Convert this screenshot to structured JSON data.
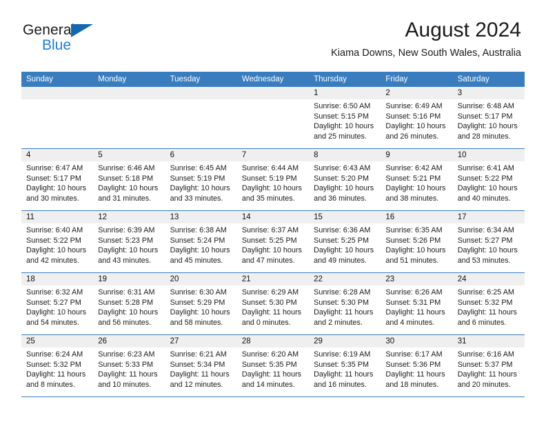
{
  "brand": {
    "name_part1": "General",
    "name_part2": "Blue",
    "triangle_color": "#1267b1",
    "blue_color": "#1b7fd4"
  },
  "header": {
    "title": "August 2024",
    "subtitle": "Kiama Downs, New South Wales, Australia"
  },
  "theme": {
    "header_blue": "#3a7dbf",
    "day_band_gray": "#efefef"
  },
  "weekdays": [
    "Sunday",
    "Monday",
    "Tuesday",
    "Wednesday",
    "Thursday",
    "Friday",
    "Saturday"
  ],
  "weeks": [
    [
      {
        "day": "",
        "lines": []
      },
      {
        "day": "",
        "lines": []
      },
      {
        "day": "",
        "lines": []
      },
      {
        "day": "",
        "lines": []
      },
      {
        "day": "1",
        "lines": [
          "Sunrise: 6:50 AM",
          "Sunset: 5:15 PM",
          "Daylight: 10 hours",
          "and 25 minutes."
        ]
      },
      {
        "day": "2",
        "lines": [
          "Sunrise: 6:49 AM",
          "Sunset: 5:16 PM",
          "Daylight: 10 hours",
          "and 26 minutes."
        ]
      },
      {
        "day": "3",
        "lines": [
          "Sunrise: 6:48 AM",
          "Sunset: 5:17 PM",
          "Daylight: 10 hours",
          "and 28 minutes."
        ]
      }
    ],
    [
      {
        "day": "4",
        "lines": [
          "Sunrise: 6:47 AM",
          "Sunset: 5:17 PM",
          "Daylight: 10 hours",
          "and 30 minutes."
        ]
      },
      {
        "day": "5",
        "lines": [
          "Sunrise: 6:46 AM",
          "Sunset: 5:18 PM",
          "Daylight: 10 hours",
          "and 31 minutes."
        ]
      },
      {
        "day": "6",
        "lines": [
          "Sunrise: 6:45 AM",
          "Sunset: 5:19 PM",
          "Daylight: 10 hours",
          "and 33 minutes."
        ]
      },
      {
        "day": "7",
        "lines": [
          "Sunrise: 6:44 AM",
          "Sunset: 5:19 PM",
          "Daylight: 10 hours",
          "and 35 minutes."
        ]
      },
      {
        "day": "8",
        "lines": [
          "Sunrise: 6:43 AM",
          "Sunset: 5:20 PM",
          "Daylight: 10 hours",
          "and 36 minutes."
        ]
      },
      {
        "day": "9",
        "lines": [
          "Sunrise: 6:42 AM",
          "Sunset: 5:21 PM",
          "Daylight: 10 hours",
          "and 38 minutes."
        ]
      },
      {
        "day": "10",
        "lines": [
          "Sunrise: 6:41 AM",
          "Sunset: 5:22 PM",
          "Daylight: 10 hours",
          "and 40 minutes."
        ]
      }
    ],
    [
      {
        "day": "11",
        "lines": [
          "Sunrise: 6:40 AM",
          "Sunset: 5:22 PM",
          "Daylight: 10 hours",
          "and 42 minutes."
        ]
      },
      {
        "day": "12",
        "lines": [
          "Sunrise: 6:39 AM",
          "Sunset: 5:23 PM",
          "Daylight: 10 hours",
          "and 43 minutes."
        ]
      },
      {
        "day": "13",
        "lines": [
          "Sunrise: 6:38 AM",
          "Sunset: 5:24 PM",
          "Daylight: 10 hours",
          "and 45 minutes."
        ]
      },
      {
        "day": "14",
        "lines": [
          "Sunrise: 6:37 AM",
          "Sunset: 5:25 PM",
          "Daylight: 10 hours",
          "and 47 minutes."
        ]
      },
      {
        "day": "15",
        "lines": [
          "Sunrise: 6:36 AM",
          "Sunset: 5:25 PM",
          "Daylight: 10 hours",
          "and 49 minutes."
        ]
      },
      {
        "day": "16",
        "lines": [
          "Sunrise: 6:35 AM",
          "Sunset: 5:26 PM",
          "Daylight: 10 hours",
          "and 51 minutes."
        ]
      },
      {
        "day": "17",
        "lines": [
          "Sunrise: 6:34 AM",
          "Sunset: 5:27 PM",
          "Daylight: 10 hours",
          "and 53 minutes."
        ]
      }
    ],
    [
      {
        "day": "18",
        "lines": [
          "Sunrise: 6:32 AM",
          "Sunset: 5:27 PM",
          "Daylight: 10 hours",
          "and 54 minutes."
        ]
      },
      {
        "day": "19",
        "lines": [
          "Sunrise: 6:31 AM",
          "Sunset: 5:28 PM",
          "Daylight: 10 hours",
          "and 56 minutes."
        ]
      },
      {
        "day": "20",
        "lines": [
          "Sunrise: 6:30 AM",
          "Sunset: 5:29 PM",
          "Daylight: 10 hours",
          "and 58 minutes."
        ]
      },
      {
        "day": "21",
        "lines": [
          "Sunrise: 6:29 AM",
          "Sunset: 5:30 PM",
          "Daylight: 11 hours",
          "and 0 minutes."
        ]
      },
      {
        "day": "22",
        "lines": [
          "Sunrise: 6:28 AM",
          "Sunset: 5:30 PM",
          "Daylight: 11 hours",
          "and 2 minutes."
        ]
      },
      {
        "day": "23",
        "lines": [
          "Sunrise: 6:26 AM",
          "Sunset: 5:31 PM",
          "Daylight: 11 hours",
          "and 4 minutes."
        ]
      },
      {
        "day": "24",
        "lines": [
          "Sunrise: 6:25 AM",
          "Sunset: 5:32 PM",
          "Daylight: 11 hours",
          "and 6 minutes."
        ]
      }
    ],
    [
      {
        "day": "25",
        "lines": [
          "Sunrise: 6:24 AM",
          "Sunset: 5:32 PM",
          "Daylight: 11 hours",
          "and 8 minutes."
        ]
      },
      {
        "day": "26",
        "lines": [
          "Sunrise: 6:23 AM",
          "Sunset: 5:33 PM",
          "Daylight: 11 hours",
          "and 10 minutes."
        ]
      },
      {
        "day": "27",
        "lines": [
          "Sunrise: 6:21 AM",
          "Sunset: 5:34 PM",
          "Daylight: 11 hours",
          "and 12 minutes."
        ]
      },
      {
        "day": "28",
        "lines": [
          "Sunrise: 6:20 AM",
          "Sunset: 5:35 PM",
          "Daylight: 11 hours",
          "and 14 minutes."
        ]
      },
      {
        "day": "29",
        "lines": [
          "Sunrise: 6:19 AM",
          "Sunset: 5:35 PM",
          "Daylight: 11 hours",
          "and 16 minutes."
        ]
      },
      {
        "day": "30",
        "lines": [
          "Sunrise: 6:17 AM",
          "Sunset: 5:36 PM",
          "Daylight: 11 hours",
          "and 18 minutes."
        ]
      },
      {
        "day": "31",
        "lines": [
          "Sunrise: 6:16 AM",
          "Sunset: 5:37 PM",
          "Daylight: 11 hours",
          "and 20 minutes."
        ]
      }
    ]
  ]
}
